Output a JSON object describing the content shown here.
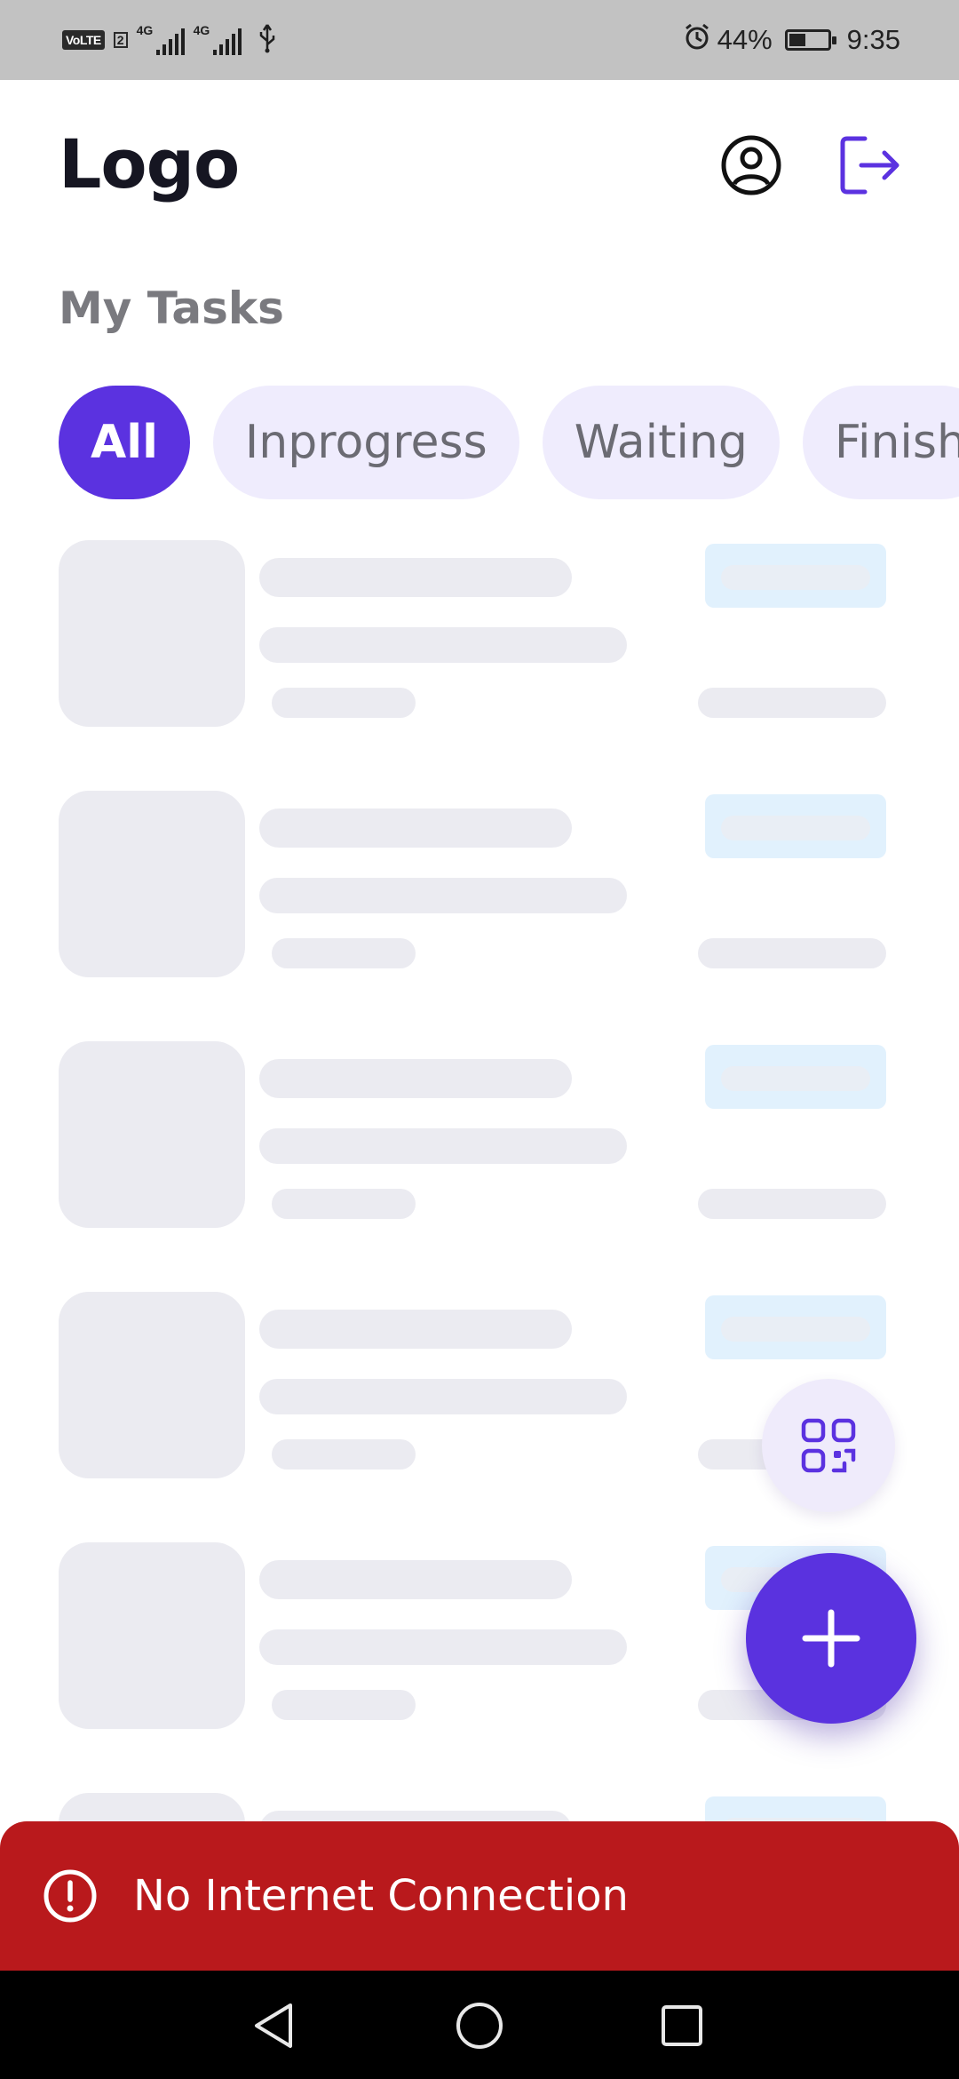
{
  "status_bar": {
    "volte_label": "VoLTE",
    "volte_sim": "2",
    "network_1": "4G",
    "network_2": "4G",
    "battery_percent": "44%",
    "battery_level": 0.44,
    "time": "9:35"
  },
  "header": {
    "logo": "Logo",
    "profile_icon": "account-circle-icon",
    "logout_icon": "logout-icon"
  },
  "section_title": "My Tasks",
  "tabs": [
    {
      "label": "All",
      "active": true
    },
    {
      "label": "Inprogress",
      "active": false
    },
    {
      "label": "Waiting",
      "active": false
    },
    {
      "label": "Finish",
      "active": false
    }
  ],
  "fab": {
    "qr_icon": "qr-code-icon",
    "add_icon": "plus-icon"
  },
  "snackbar": {
    "icon": "alert-circle-icon",
    "message": "No Internet Connection"
  },
  "nav_bar": {
    "back_icon": "back-triangle-icon",
    "home_icon": "home-circle-icon",
    "recents_icon": "recents-square-icon"
  },
  "colors": {
    "accent": "#5b32e0",
    "tab_bg": "#efecfd",
    "skeleton": "#ebebf1",
    "error": "#b9191c"
  }
}
